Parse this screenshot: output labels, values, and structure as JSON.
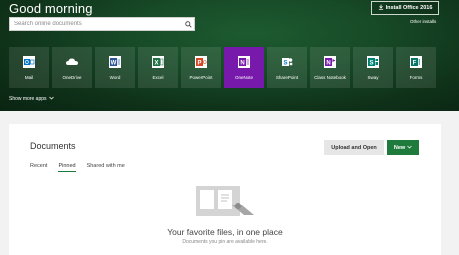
{
  "header": {
    "greeting": "Good morning",
    "search_placeholder": "Search online documents",
    "install_label": "Install Office 2016",
    "other_installs_label": "Other installs"
  },
  "apps": [
    {
      "label": "Mail",
      "icon": "mail-icon",
      "color": "#0072c6"
    },
    {
      "label": "OneDrive",
      "icon": "onedrive-icon",
      "color": "#094ab2"
    },
    {
      "label": "Word",
      "icon": "word-icon",
      "color": "#2b579a"
    },
    {
      "label": "Excel",
      "icon": "excel-icon",
      "color": "#217346"
    },
    {
      "label": "PowerPoint",
      "icon": "powerpoint-icon",
      "color": "#d24726"
    },
    {
      "label": "OneNote",
      "icon": "onenote-icon",
      "color": "#7719aa"
    },
    {
      "label": "SharePoint",
      "icon": "sharepoint-icon",
      "color": "#0078d7"
    },
    {
      "label": "Class Notebook",
      "icon": "class-notebook-icon",
      "color": "#7719aa"
    },
    {
      "label": "Sway",
      "icon": "sway-icon",
      "color": "#008272"
    },
    {
      "label": "Forms",
      "icon": "forms-icon",
      "color": "#077568"
    }
  ],
  "selected_app": "OneNote",
  "show_more_label": "Show more apps",
  "documents": {
    "title": "Documents",
    "upload_label": "Upload and Open",
    "new_label": "New",
    "tabs": [
      {
        "label": "Recent",
        "active": false
      },
      {
        "label": "Pinned",
        "active": true
      },
      {
        "label": "Shared with me",
        "active": false
      }
    ],
    "empty_title": "Your favorite files, in one place",
    "empty_subtitle": "Documents you pin are available here."
  },
  "colors": {
    "hero_bg": "#174a27",
    "accent_green": "#1e7b3c",
    "onenote_purple": "#7719aa"
  }
}
